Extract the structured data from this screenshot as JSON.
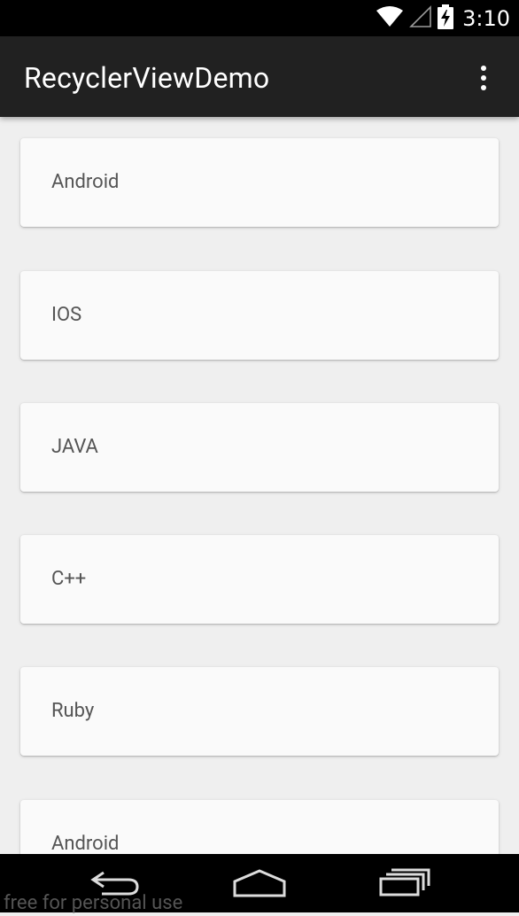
{
  "status_bar": {
    "time": "3:10",
    "icons": [
      "wifi-icon",
      "signal-icon",
      "battery-charging-icon"
    ]
  },
  "app_bar": {
    "title": "RecyclerViewDemo",
    "overflow_icon": "more-vert-icon"
  },
  "list": {
    "items": [
      {
        "label": "Android"
      },
      {
        "label": "IOS"
      },
      {
        "label": "JAVA"
      },
      {
        "label": "C++"
      },
      {
        "label": "Ruby"
      },
      {
        "label": "Android"
      }
    ]
  },
  "nav_bar": {
    "icons": [
      "back-icon",
      "home-icon",
      "recents-icon"
    ]
  },
  "watermark": "free for personal use"
}
